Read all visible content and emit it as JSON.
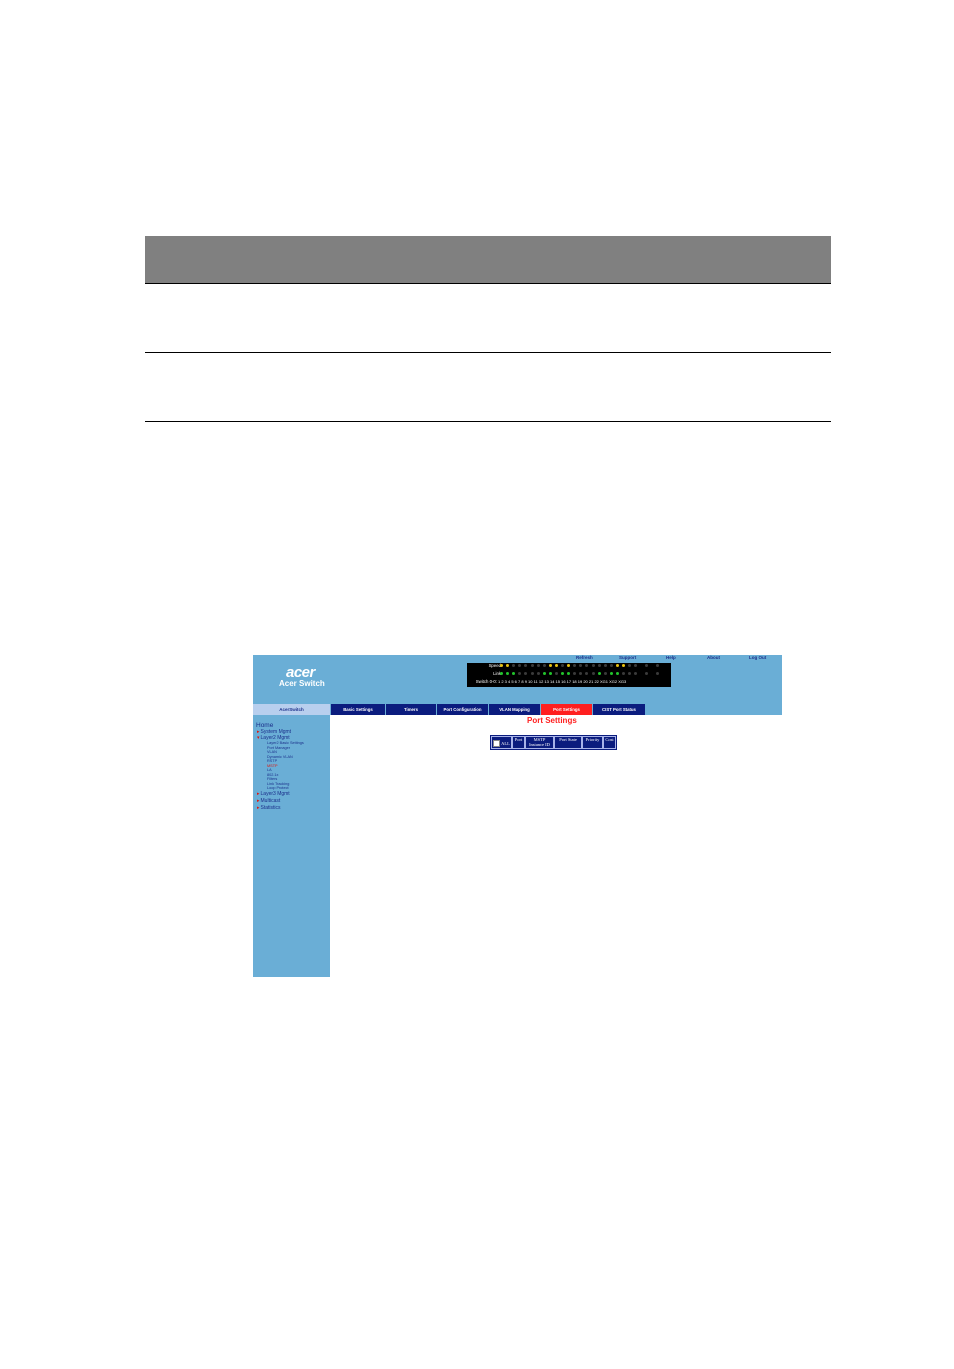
{
  "top_links": [
    "Refresh",
    "Support",
    "Help",
    "About",
    "Log Out"
  ],
  "logo_text": "acer",
  "brand_name": "Acer Switch",
  "panel": {
    "speed_label": "Speed",
    "link_label": "Link",
    "switch_label": "Switch 0-0:",
    "port_numbers": "1  2  3  4  5  6  7  8  9 10 11 12 13 14 15 16 17 18 19 20 21 22 XG1 XG2 XG3",
    "colors": {
      "amber": "#e8c211",
      "green": "#21c42b",
      "off": "#3a3a3a"
    }
  },
  "tabs": {
    "home": "AcerSwitch",
    "items": [
      "Basic Settings",
      "Timers",
      "Port Configuration",
      "VLAN Mapping",
      "Port Settings",
      "CIST Port Status"
    ],
    "active": "Port Settings"
  },
  "sidebar": {
    "home": "Home",
    "system_mgmt": "System Mgmt",
    "layer2_mgmt": "Layer2 Mgmt",
    "layer2_items": [
      "Layer2 Basic Settings",
      "Port Manager",
      "VLAN",
      "Dynamic VLAN",
      "RSTP",
      "MSTP",
      "LA",
      "802.1x",
      "Filters",
      "Link Tracking",
      "Loop Protect"
    ],
    "active_item": "MSTP",
    "layer3_mgmt": "Layer3 Mgmt",
    "multicast": "Multicast",
    "statistics": "Statistics"
  },
  "content": {
    "title": "Port Settings",
    "columns": {
      "all": "ALL",
      "port": "Port",
      "mstp_line1": "MSTP",
      "mstp_line2": "Instance ID",
      "port_state": "Port State",
      "priority": "Priority",
      "cost": "Cost"
    }
  },
  "theme": {
    "light_blue": "#6aaed6",
    "navy": "#0b1c7e",
    "red": "#ff1f1f",
    "doc_header_gray": "#808080"
  }
}
